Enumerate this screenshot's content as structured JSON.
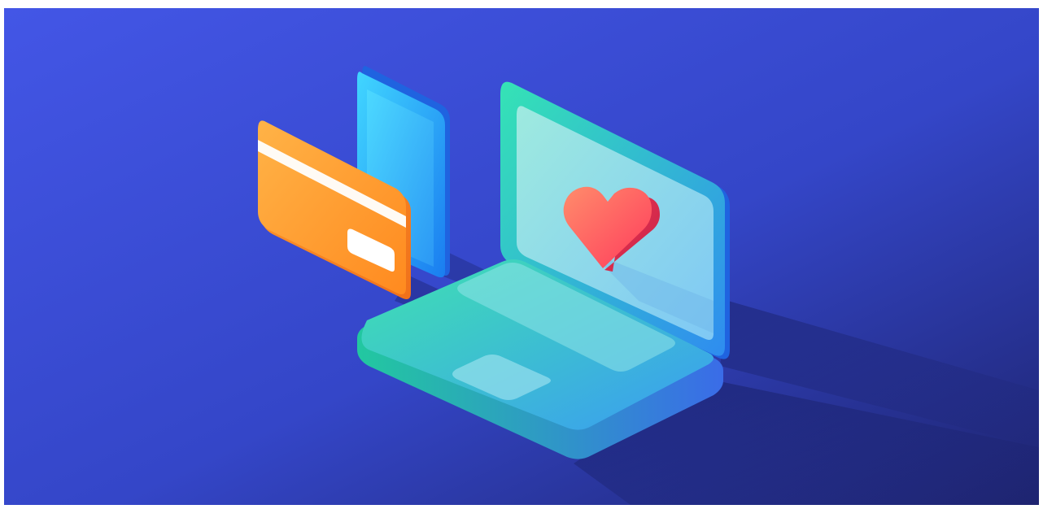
{
  "illustration": {
    "objects": [
      "credit-card",
      "smartphone",
      "laptop",
      "heart"
    ],
    "colors": {
      "background_start": "#4356E6",
      "background_end": "#1E2470",
      "card_start": "#FFB347",
      "card_end": "#FF8A1F",
      "phone_start": "#41D6FF",
      "phone_end": "#1A7DF0",
      "laptop_start": "#35E3B5",
      "laptop_end": "#2F8CF0",
      "screen_fill": "#8ED9F0",
      "heart_start": "#FF8C6B",
      "heart_end": "#FF3B5C"
    }
  }
}
